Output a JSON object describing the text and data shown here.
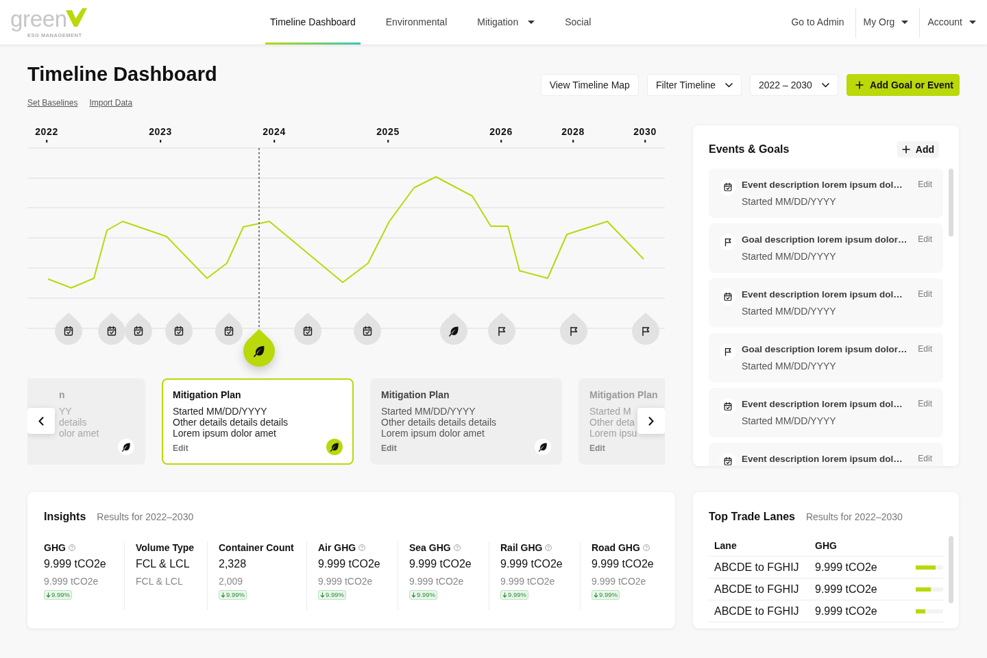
{
  "header": {
    "logo": {
      "wordmark": "green",
      "tagline": "ESG MANAGEMENT"
    },
    "nav": [
      {
        "label": "Timeline Dashboard",
        "selected": true,
        "dropdown": false
      },
      {
        "label": "Environmental",
        "selected": false,
        "dropdown": false
      },
      {
        "label": "Mitigation",
        "selected": false,
        "dropdown": true
      },
      {
        "label": "Social",
        "selected": false,
        "dropdown": false
      }
    ],
    "user_menu": [
      {
        "label": "Go to Admin",
        "dropdown": false
      },
      {
        "label": "My Org",
        "dropdown": true
      },
      {
        "label": "Account",
        "dropdown": true
      }
    ]
  },
  "page": {
    "title": "Timeline Dashboard",
    "links": [
      "Set Baselines",
      "Import Data"
    ],
    "actions": [
      {
        "label": "View Timeline Map",
        "kind": "plain"
      },
      {
        "label": "Filter Timeline",
        "kind": "dropdown"
      },
      {
        "label": "2022 – 2030",
        "kind": "dropdown"
      },
      {
        "label": "Add Goal or Event",
        "kind": "primary"
      }
    ]
  },
  "timeline": {
    "years": [
      "2022",
      "2023",
      "2024",
      "2025",
      "2026",
      "2028",
      "2030"
    ],
    "markers": [
      {
        "kind": "event",
        "selected": false
      },
      {
        "kind": "event",
        "selected": false
      },
      {
        "kind": "event",
        "selected": false
      },
      {
        "kind": "event",
        "selected": false
      },
      {
        "kind": "event",
        "selected": false
      },
      {
        "kind": "mitigation",
        "selected": true
      },
      {
        "kind": "event",
        "selected": false
      },
      {
        "kind": "event",
        "selected": false
      },
      {
        "kind": "mitigation",
        "selected": false
      },
      {
        "kind": "goal",
        "selected": false
      },
      {
        "kind": "goal",
        "selected": false
      },
      {
        "kind": "goal",
        "selected": false
      }
    ],
    "cards": [
      {
        "kind": "cut_left",
        "title": "n",
        "lines": [
          "YY",
          "details",
          "olor amet"
        ],
        "selected": false
      },
      {
        "kind": "full",
        "title": "Mitigation Plan",
        "lines": [
          "Started MM/DD/YYYY",
          "Other details details details",
          "Lorem ipsum dolor amet"
        ],
        "edit": "Edit",
        "selected": true
      },
      {
        "kind": "full",
        "title": "Mitigation Plan",
        "lines": [
          "Started MM/DD/YYYY",
          "Other details details details",
          "Lorem ipsum dolor amet"
        ],
        "edit": "Edit",
        "selected": false
      },
      {
        "kind": "cut_right",
        "title": "Mitigation Plan",
        "lines": [
          "Started M",
          "Other deta",
          "Lorem ipsu"
        ],
        "edit": "Edit",
        "selected": false
      }
    ]
  },
  "events_goals": {
    "title": "Events & Goals",
    "add": "Add",
    "items": [
      {
        "kind": "event",
        "title": "Event description lorem ipsum dol…",
        "subtitle": "Started MM/DD/YYYY",
        "edit": "Edit"
      },
      {
        "kind": "goal",
        "title": "Goal description lorem ipsum dolor…",
        "subtitle": "Started MM/DD/YYYY",
        "edit": "Edit"
      },
      {
        "kind": "event",
        "title": "Event description lorem ipsum dol…",
        "subtitle": "Started MM/DD/YYYY",
        "edit": "Edit"
      },
      {
        "kind": "goal",
        "title": "Goal description lorem ipsum dolor…",
        "subtitle": "Started MM/DD/YYYY",
        "edit": "Edit"
      },
      {
        "kind": "event",
        "title": "Event description lorem ipsum dol…",
        "subtitle": "Started MM/DD/YYYY",
        "edit": "Edit"
      },
      {
        "kind": "event",
        "title": "Event description lorem ipsum dol…",
        "edit": "Edit"
      }
    ]
  },
  "insights": {
    "title": "Insights",
    "subtitle": "Results for 2022–2030",
    "metrics": [
      {
        "label": "GHG",
        "help": true,
        "value": "9.999 tCO2e",
        "previous": "9.999 tCO2e",
        "change": "9.99%",
        "decreased": true
      },
      {
        "label": "Volume Type",
        "help": false,
        "value": "FCL & LCL",
        "previous": "FCL & LCL"
      },
      {
        "label": "Container Count",
        "help": false,
        "value": "2,328",
        "previous": "2,009",
        "change": "9.99%",
        "decreased": true
      },
      {
        "label": "Air GHG",
        "help": true,
        "value": "9.999 tCO2e",
        "previous": "9.999 tCO2e",
        "change": "9.99%",
        "decreased": true
      },
      {
        "label": "Sea GHG",
        "help": true,
        "value": "9.999 tCO2e",
        "previous": "9.999 tCO2e",
        "change": "9.99%",
        "decreased": true
      },
      {
        "label": "Rail GHG",
        "help": true,
        "value": "9.999 tCO2e",
        "previous": "9.999 tCO2e",
        "change": "9.99%",
        "decreased": true
      },
      {
        "label": "Road GHG",
        "help": true,
        "value": "9.999 tCO2e",
        "previous": "9.999 tCO2e",
        "change": "9.99%",
        "decreased": true
      }
    ]
  },
  "trade_lanes": {
    "title": "Top Trade Lanes",
    "subtitle": "Results for 2022–2030",
    "columns": [
      "Lane",
      "GHG"
    ],
    "rows": [
      {
        "lane": "ABCDE to FGHIJ",
        "ghg": "9.999 tCO2e",
        "level": 0.72
      },
      {
        "lane": "ABCDE to FGHIJ",
        "ghg": "9.999 tCO2e",
        "level": 0.55
      },
      {
        "lane": "ABCDE to FGHIJ",
        "ghg": "9.999 tCO2e",
        "level": 0.35
      }
    ]
  }
}
